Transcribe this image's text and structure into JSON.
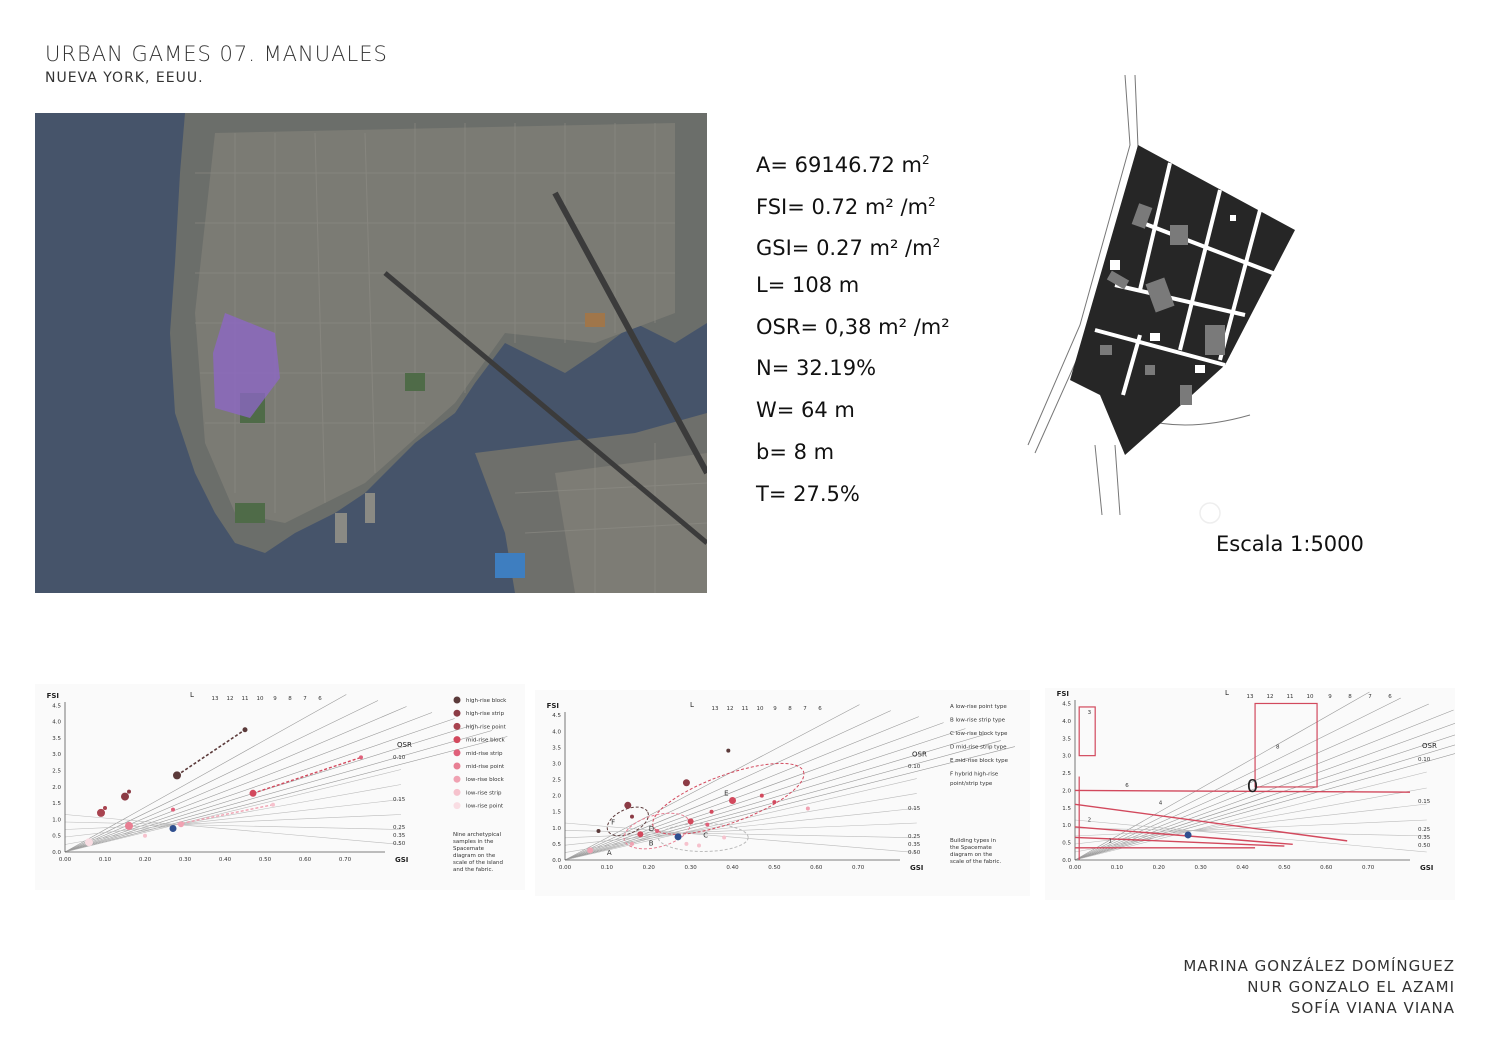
{
  "header": {
    "title": "URBAN GAMES 07. MANUALES",
    "subtitle": "NUEVA YORK, EEUU."
  },
  "metrics": [
    {
      "label": "A= 69146.72 m",
      "sup": "2",
      "tail": ""
    },
    {
      "label": "FSI= 0.72 m² /m",
      "sup": "2",
      "tail": ""
    },
    {
      "label": "GSI= 0.27 m² /m",
      "sup": "2",
      "tail": ""
    },
    {
      "label": "L= 108 m",
      "sup": "",
      "tail": ""
    },
    {
      "label": "OSR= 0,38 m² /m²",
      "sup": "",
      "tail": ""
    },
    {
      "label": "N= 32.19%",
      "sup": "",
      "tail": ""
    },
    {
      "label": "W= 64 m",
      "sup": "",
      "tail": ""
    },
    {
      "label": "b= 8 m",
      "sup": "",
      "tail": ""
    },
    {
      "label": "T= 27.5%",
      "sup": "",
      "tail": ""
    }
  ],
  "plan": {
    "scale_label": "Escala 1:5000"
  },
  "charts": {
    "axis": {
      "fsi_label": "FSI",
      "gsi_label": "GSI",
      "osr_label": "OSR",
      "l_label": "L",
      "y_ticks": [
        "0.0",
        "0.5",
        "1.0",
        "1.5",
        "2.0",
        "2.5",
        "3.0",
        "3.5",
        "4.0",
        "4.5"
      ],
      "x_ticks": [
        "0.00",
        "0.10",
        "0.20",
        "0.30",
        "0.40",
        "0.50",
        "0.60",
        "0.70"
      ],
      "l_ticks": [
        "13",
        "12",
        "11",
        "10",
        "9",
        "8",
        "7",
        "6"
      ],
      "osr_ticks": [
        "0.10",
        "0.15",
        "0.25",
        "0.35",
        "0.50"
      ]
    },
    "chart1": {
      "legend": [
        "high-rise block",
        "high-rise strip",
        "high-rise point",
        "mid-rise block",
        "mid-rise strip",
        "mid-rise point",
        "low-rise block",
        "low-rise strip",
        "low-rise point"
      ],
      "legend_colors": [
        "#5b3a3a",
        "#8c3b45",
        "#a8434f",
        "#d2495d",
        "#e0607a",
        "#e87f93",
        "#f0a2b2",
        "#f6c2cd",
        "#f9dde3"
      ],
      "caption": [
        "Nine archetypical",
        "samples in the",
        "Spacemate",
        "diagram on the",
        "scale of the island",
        "and the fabric."
      ]
    },
    "chart2": {
      "legend": [
        "A  low-rise point type",
        "B  low-rise strip type",
        "C  low-rise block type",
        "D  mid-rise strip type",
        "E  mid-rise block type",
        "F  hybrid high-rise",
        "point/strip type"
      ],
      "caption": [
        "Building types in",
        "the Spacemate",
        "diagram on the",
        "scale of the fabric."
      ],
      "cluster_labels": [
        "A",
        "B",
        "C",
        "D",
        "E",
        "F"
      ]
    },
    "chart3": {
      "zero_label": "0",
      "line_labels": [
        "1",
        "2",
        "4",
        "6",
        "3",
        "8"
      ]
    },
    "site_point": {
      "gsi": 0.27,
      "fsi": 0.72,
      "color": "#2f4f8f"
    }
  },
  "credits": [
    "MARINA GONZÁLEZ DOMÍNGUEZ",
    "NUR GONZALO EL AZAMI",
    "SOFÍA VIANA VIANA"
  ]
}
